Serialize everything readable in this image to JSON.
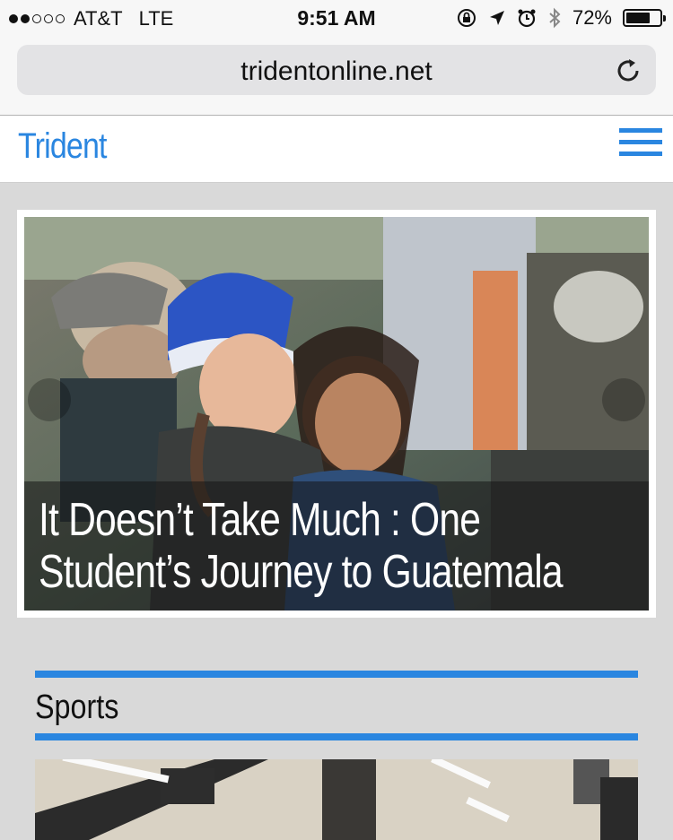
{
  "status_bar": {
    "carrier": "AT&T",
    "network": "LTE",
    "time": "9:51 AM",
    "battery": "72%",
    "battery_level": 0.72,
    "signal_bars": 2
  },
  "browser": {
    "url": "tridentonline.net"
  },
  "site": {
    "logo": "Trident"
  },
  "featured": {
    "headline_line1": "It Doesn’t Take Much : One",
    "headline_line2": "Student’s Journey to Guatemala"
  },
  "sections": {
    "sports_title": "Sports"
  },
  "colors": {
    "accent": "#2a86e0",
    "page_bg": "#d9d9d9"
  }
}
